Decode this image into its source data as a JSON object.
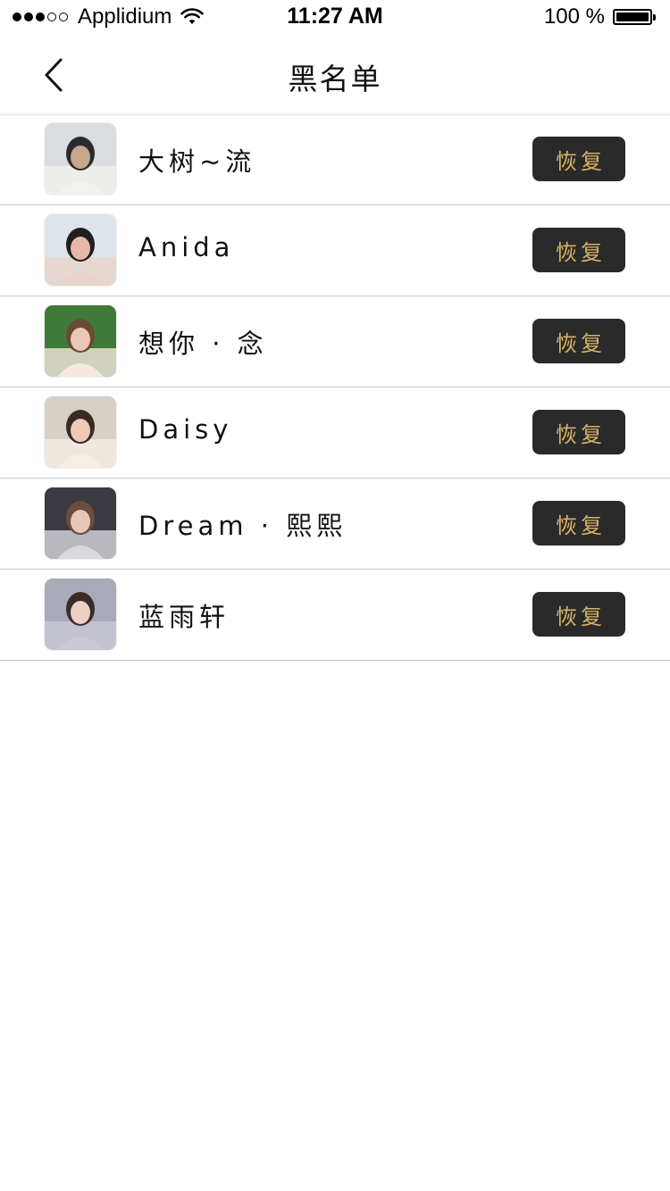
{
  "status_bar": {
    "carrier": "Applidium",
    "time": "11:27 AM",
    "battery": "100 %",
    "battery_level": 1.0
  },
  "nav": {
    "title": "黑名单",
    "back_icon": "chevron-left-icon"
  },
  "users": [
    {
      "name": "大树~流",
      "action_label": "恢复",
      "avatar_colors": [
        "#d9dde0",
        "#f1f1ee",
        "#2b2b2b",
        "#c8a58e"
      ]
    },
    {
      "name": "Anida",
      "action_label": "恢复",
      "avatar_colors": [
        "#dfe4ea",
        "#e9d3cb",
        "#1f1f1f",
        "#e6b9a9"
      ]
    },
    {
      "name": "想你 · 念",
      "action_label": "恢复",
      "avatar_colors": [
        "#3f7a3a",
        "#f5e9de",
        "#6b4a33",
        "#e9c9b5"
      ]
    },
    {
      "name": "Daisy",
      "action_label": "恢复",
      "avatar_colors": [
        "#d7d0c8",
        "#f4eee6",
        "#3a2a22",
        "#ecc9b8"
      ]
    },
    {
      "name": "Dream · 熙熙",
      "action_label": "恢复",
      "avatar_colors": [
        "#3b3a40",
        "#d8d8de",
        "#6b4d3f",
        "#e8c7b8"
      ]
    },
    {
      "name": "蓝雨轩",
      "action_label": "恢复",
      "avatar_colors": [
        "#a9aab7",
        "#c9c9d4",
        "#3a2c28",
        "#ecd0c3"
      ]
    }
  ],
  "colors": {
    "button_bg": "#2a2a2a",
    "button_text": "#d8b366",
    "divider": "#c8c8c8"
  }
}
